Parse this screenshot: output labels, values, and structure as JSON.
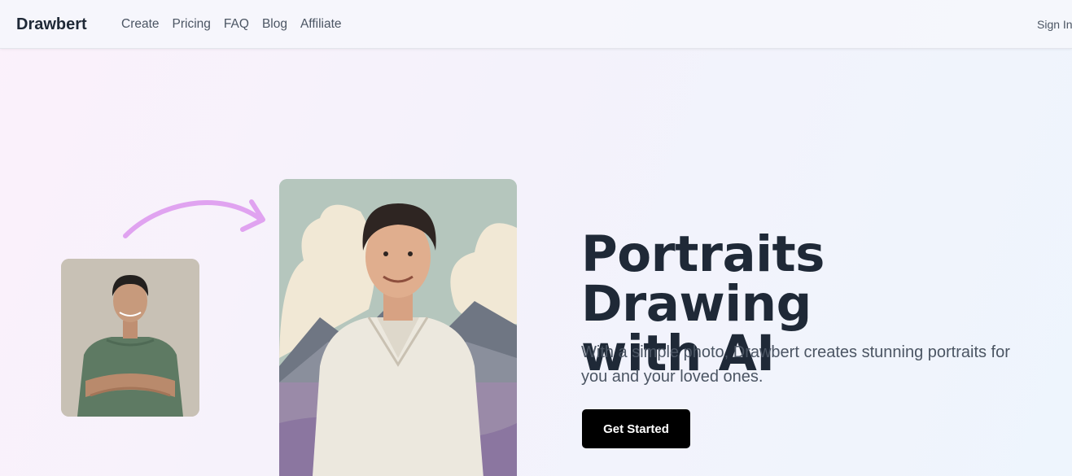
{
  "nav": {
    "brand": "Drawbert",
    "links": [
      "Create",
      "Pricing",
      "FAQ",
      "Blog",
      "Affiliate"
    ],
    "sign_in": "Sign In"
  },
  "hero": {
    "title_line1": "Portraits Drawing",
    "title_line2": "with AI",
    "subtitle": "With a simple photo, Drawbert creates stunning portraits for you and your loved ones.",
    "cta_label": "Get Started"
  },
  "colors": {
    "arrow": "#e0a3f0",
    "cta_background": "#000000",
    "title": "#1f2937"
  },
  "icons": {
    "arrow": "curved-arrow-icon"
  }
}
